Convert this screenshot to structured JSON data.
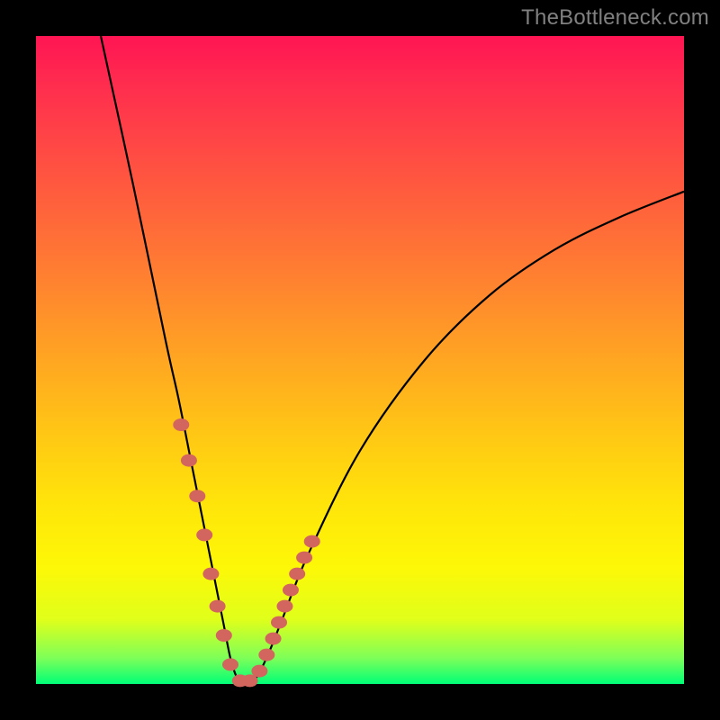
{
  "watermark": "TheBottleneck.com",
  "colors": {
    "marker": "#d3655f",
    "curve": "#000000",
    "background": "#000000"
  },
  "chart_data": {
    "type": "line",
    "title": "",
    "xlabel": "",
    "ylabel": "",
    "xlim": [
      0,
      100
    ],
    "ylim": [
      0,
      100
    ],
    "grid": false,
    "annotations": [
      "TheBottleneck.com"
    ],
    "series": [
      {
        "name": "bottleneck-curve",
        "x": [
          10,
          15,
          20,
          22,
          24,
          26,
          28,
          29,
          30,
          31,
          32,
          34,
          36,
          38,
          42,
          50,
          60,
          70,
          80,
          90,
          100
        ],
        "y": [
          100,
          77,
          53,
          44,
          34,
          24,
          14,
          9,
          4,
          1,
          0,
          1,
          5,
          10,
          20,
          36,
          50,
          60,
          67,
          72,
          76
        ]
      }
    ],
    "markers": {
      "name": "highlight-points",
      "x": [
        22.4,
        23.6,
        24.9,
        26.0,
        27.0,
        28.0,
        29.0,
        30.0,
        31.5,
        33.0,
        34.5,
        35.6,
        36.6,
        37.5,
        38.4,
        39.3,
        40.3,
        41.4,
        42.6
      ],
      "y": [
        40.0,
        34.5,
        29.0,
        23.0,
        17.0,
        12.0,
        7.5,
        3.0,
        0.5,
        0.5,
        2.0,
        4.5,
        7.0,
        9.5,
        12.0,
        14.5,
        17.0,
        19.5,
        22.0
      ]
    }
  }
}
